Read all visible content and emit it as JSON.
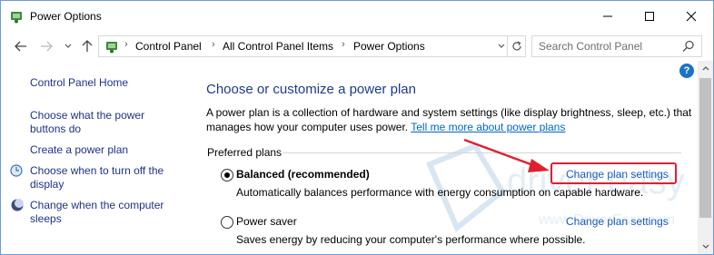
{
  "window": {
    "title": "Power Options",
    "icons": {
      "app": "power-options-icon",
      "minimize": "minimize-icon",
      "maximize": "maximize-icon",
      "close": "close-icon"
    }
  },
  "address_bar": {
    "breadcrumbs": [
      "Control Panel",
      "All Control Panel Items",
      "Power Options"
    ],
    "search_placeholder": "Search Control Panel"
  },
  "sidebar": {
    "home": "Control Panel Home",
    "links": [
      {
        "label": "Choose what the power buttons do",
        "icon": null
      },
      {
        "label": "Create a power plan",
        "icon": null
      },
      {
        "label": "Choose when to turn off the display",
        "icon": "display-timer-icon"
      },
      {
        "label": "Change when the computer sleeps",
        "icon": "moon-icon"
      }
    ]
  },
  "main": {
    "heading": "Choose or customize a power plan",
    "description": "A power plan is a collection of hardware and system settings (like display brightness, sleep, etc.) that manages how your computer uses power.",
    "learn_more": "Tell me more about power plans",
    "group_label": "Preferred plans",
    "plans": [
      {
        "name": "Balanced (recommended)",
        "selected": true,
        "description": "Automatically balances performance with energy consumption on capable hardware.",
        "link": "Change plan settings"
      },
      {
        "name": "Power saver",
        "selected": false,
        "description": "Saves energy by reducing your computer's performance where possible.",
        "link": "Change plan settings"
      }
    ]
  },
  "watermark": {
    "brand": "driver easy",
    "url": "www.DriverEasy.com"
  },
  "colors": {
    "link": "#1e3287",
    "heading": "#1e3a8c",
    "annotation": "#e0202e"
  }
}
